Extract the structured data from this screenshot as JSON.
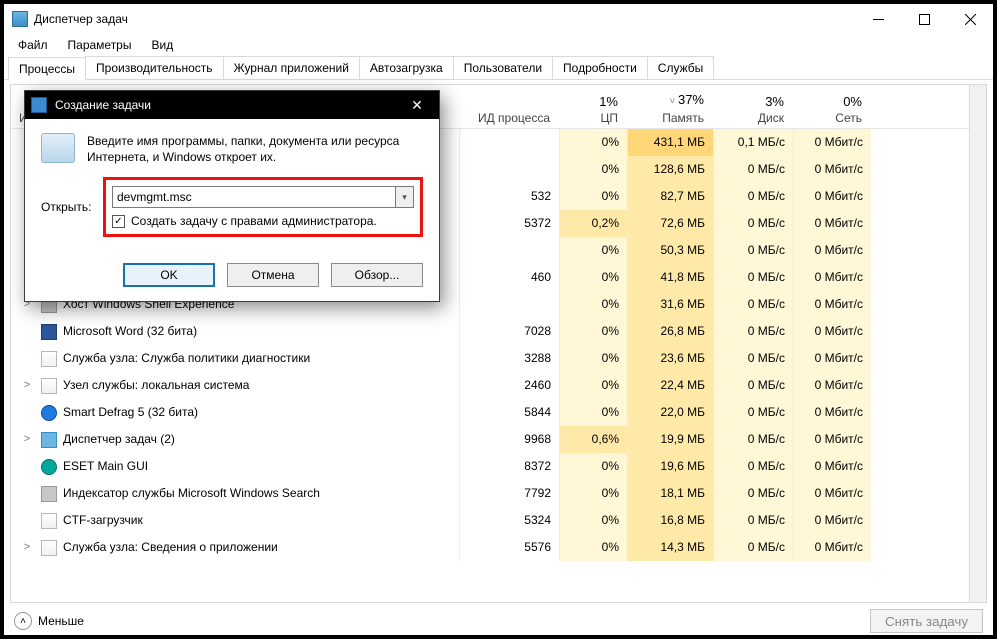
{
  "window": {
    "title": "Диспетчер задач",
    "menus": [
      "Файл",
      "Параметры",
      "Вид"
    ],
    "tabs": [
      "Процессы",
      "Производительность",
      "Журнал приложений",
      "Автозагрузка",
      "Пользователи",
      "Подробности",
      "Службы"
    ],
    "active_tab": 0,
    "fewer": "Меньше",
    "end_task": "Снять задачу"
  },
  "columns": {
    "name": "Им",
    "pid": "ИД процесса",
    "cpu": {
      "pct": "1%",
      "label": "ЦП"
    },
    "mem": {
      "pct": "37%",
      "label": "Память"
    },
    "disk": {
      "pct": "3%",
      "label": "Диск"
    },
    "net": {
      "pct": "0%",
      "label": "Сеть"
    }
  },
  "rows": [
    {
      "exp": ">",
      "name": "",
      "pid": "",
      "cpu": "0%",
      "mem": "431,1 МБ",
      "disk": "0,1 МБ/с",
      "net": "0 Мбит/с",
      "memHot": true,
      "icon": "w"
    },
    {
      "exp": ">",
      "name": "",
      "pid": "",
      "cpu": "0%",
      "mem": "128,6 МБ",
      "disk": "0 МБ/с",
      "net": "0 Мбит/с",
      "icon": "w"
    },
    {
      "exp": ">",
      "name": "",
      "pid": "532",
      "cpu": "0%",
      "mem": "82,7 МБ",
      "disk": "0 МБ/с",
      "net": "0 Мбит/с",
      "icon": "w"
    },
    {
      "exp": ">",
      "name": "",
      "pid": "5372",
      "cpu": "0,2%",
      "mem": "72,6 МБ",
      "disk": "0 МБ/с",
      "net": "0 Мбит/с",
      "cpuHot": true,
      "icon": "w"
    },
    {
      "exp": ">",
      "name": "",
      "pid": "",
      "cpu": "0%",
      "mem": "50,3 МБ",
      "disk": "0 МБ/с",
      "net": "0 Мбит/с",
      "icon": "w"
    },
    {
      "exp": ">",
      "name": "",
      "pid": "460",
      "cpu": "0%",
      "mem": "41,8 МБ",
      "disk": "0 МБ/с",
      "net": "0 Мбит/с",
      "icon": "w"
    },
    {
      "exp": ">",
      "name": "Хост Windows Shell Experience",
      "pid": "",
      "cpu": "0%",
      "mem": "31,6 МБ",
      "disk": "0 МБ/с",
      "net": "0 Мбит/с",
      "icon": "w"
    },
    {
      "exp": "",
      "name": "Microsoft Word (32 бита)",
      "pid": "7028",
      "cpu": "0%",
      "mem": "26,8 МБ",
      "disk": "0 МБ/с",
      "net": "0 Мбит/с",
      "icon": "blue"
    },
    {
      "exp": "",
      "name": "Служба узла: Служба политики диагностики",
      "pid": "3288",
      "cpu": "0%",
      "mem": "23,6 МБ",
      "disk": "0 МБ/с",
      "net": "0 Мбит/с",
      "icon": "o"
    },
    {
      "exp": ">",
      "name": "Узел службы: локальная система",
      "pid": "2460",
      "cpu": "0%",
      "mem": "22,4 МБ",
      "disk": "0 МБ/с",
      "net": "0 Мбит/с",
      "icon": "o"
    },
    {
      "exp": "",
      "name": "Smart Defrag 5 (32 бита)",
      "pid": "5844",
      "cpu": "0%",
      "mem": "22,0 МБ",
      "disk": "0 МБ/с",
      "net": "0 Мбит/с",
      "icon": "db"
    },
    {
      "exp": ">",
      "name": "Диспетчер задач (2)",
      "pid": "9968",
      "cpu": "0,6%",
      "mem": "19,9 МБ",
      "disk": "0 МБ/с",
      "net": "0 Мбит/с",
      "cpuHot": true
    },
    {
      "exp": "",
      "name": "ESET Main GUI",
      "pid": "8372",
      "cpu": "0%",
      "mem": "19,6 МБ",
      "disk": "0 МБ/с",
      "net": "0 Мбит/с",
      "icon": "e"
    },
    {
      "exp": "",
      "name": "Индексатор службы Microsoft Windows Search",
      "pid": "7792",
      "cpu": "0%",
      "mem": "18,1 МБ",
      "disk": "0 МБ/с",
      "net": "0 Мбит/с",
      "icon": "w"
    },
    {
      "exp": "",
      "name": "CTF-загрузчик",
      "pid": "5324",
      "cpu": "0%",
      "mem": "16,8 МБ",
      "disk": "0 МБ/с",
      "net": "0 Мбит/с",
      "icon": "o"
    },
    {
      "exp": ">",
      "name": "Служба узла: Сведения о приложении",
      "pid": "5576",
      "cpu": "0%",
      "mem": "14,3 МБ",
      "disk": "0 МБ/с",
      "net": "0 Мбит/с",
      "icon": "o"
    }
  ],
  "dialog": {
    "title": "Создание задачи",
    "description": "Введите имя программы, папки, документа или ресурса Интернета, и Windows откроет их.",
    "open_label": "Открыть:",
    "open_value": "devmgmt.msc",
    "admin_checkbox": "Создать задачу с правами администратора.",
    "admin_checked": true,
    "ok": "OK",
    "cancel": "Отмена",
    "browse": "Обзор..."
  }
}
